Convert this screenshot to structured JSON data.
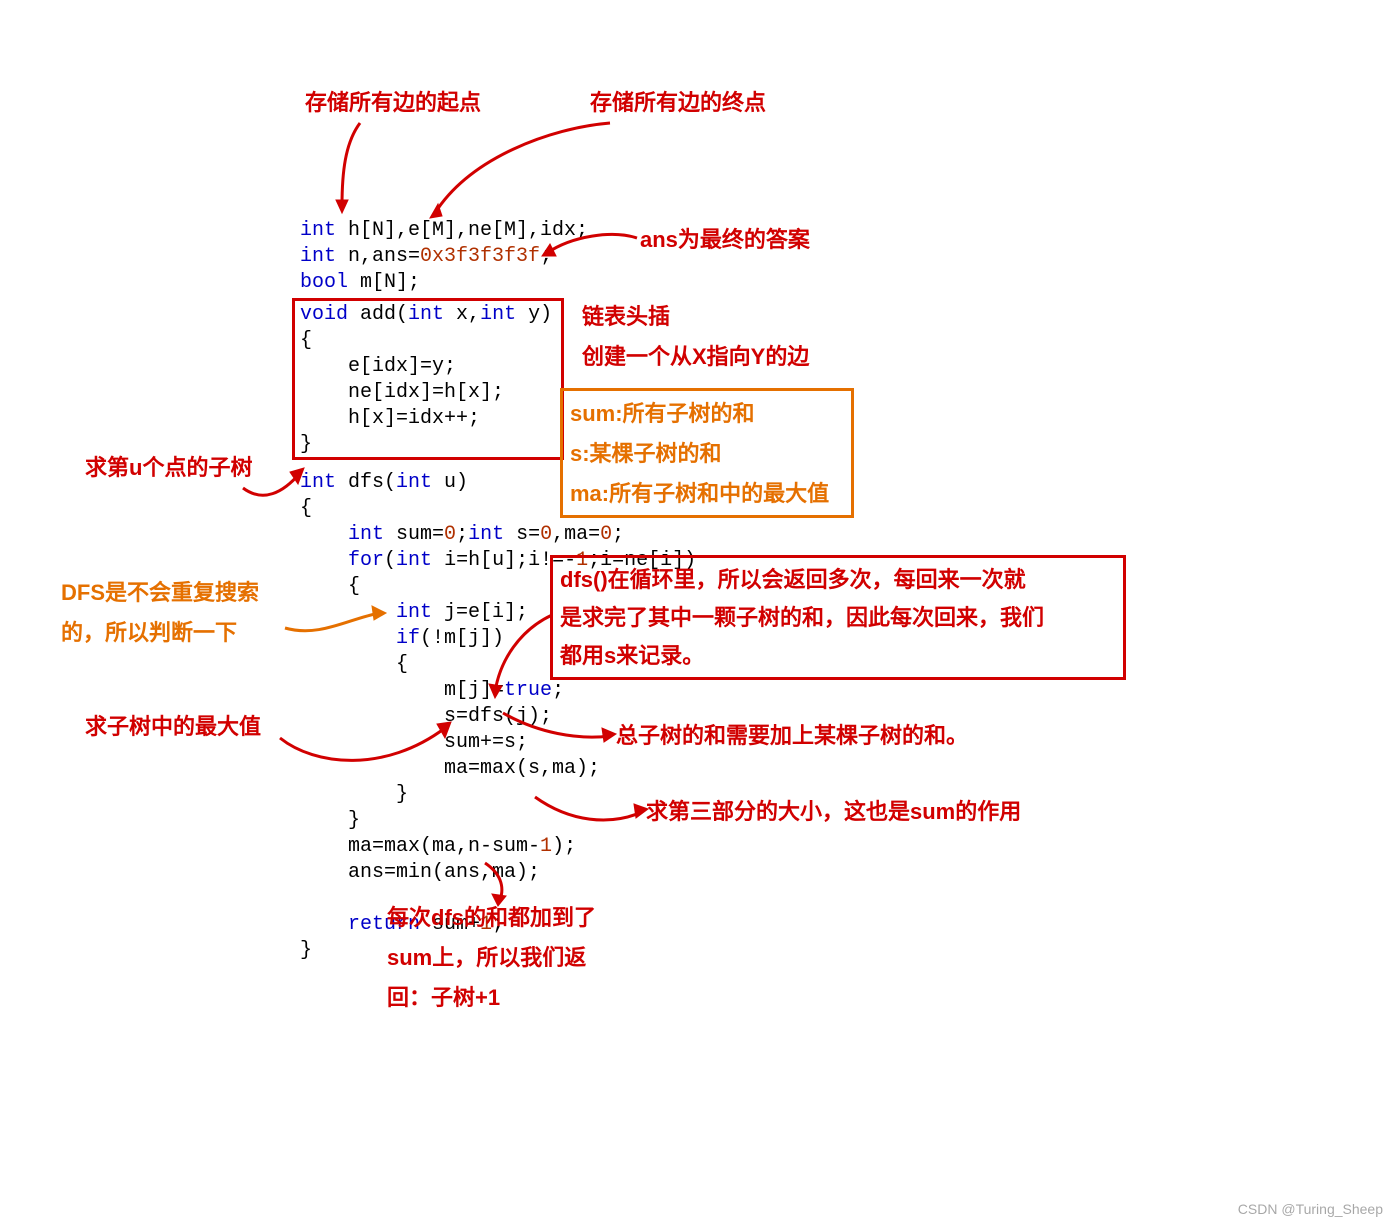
{
  "annotations": {
    "top_h": "存储所有边的起点",
    "top_e": "存储所有边的终点",
    "ans_note": "ans为最终的答案",
    "add_note_1": "链表头插",
    "add_note_2": "创建一个从X指向Y的边",
    "sum_note_1": "sum:所有子树的和",
    "sum_note_2": "s:某棵子树的和",
    "sum_note_3": "ma:所有子树和中的最大值",
    "dfs_u_note": "求第u个点的子树",
    "dfs_repeat_1": "DFS是不会重复搜索",
    "dfs_repeat_2": "的，所以判断一下",
    "dfs_loop_1": "dfs()在循环里，所以会返回多次，每回来一次就",
    "dfs_loop_2": "是求完了其中一颗子树的和，因此每次回来，我们",
    "dfs_loop_3": "都用s来记录。",
    "max_subtree": "求子树中的最大值",
    "total_subtree": "总子树的和需要加上某棵子树的和。",
    "part3": "求第三部分的大小，这也是sum的作用",
    "return_1": "每次dfs的和都加到了",
    "return_2": "sum上，所以我们返",
    "return_3": "回：子树+1"
  },
  "watermark": "CSDN @Turing_Sheep"
}
